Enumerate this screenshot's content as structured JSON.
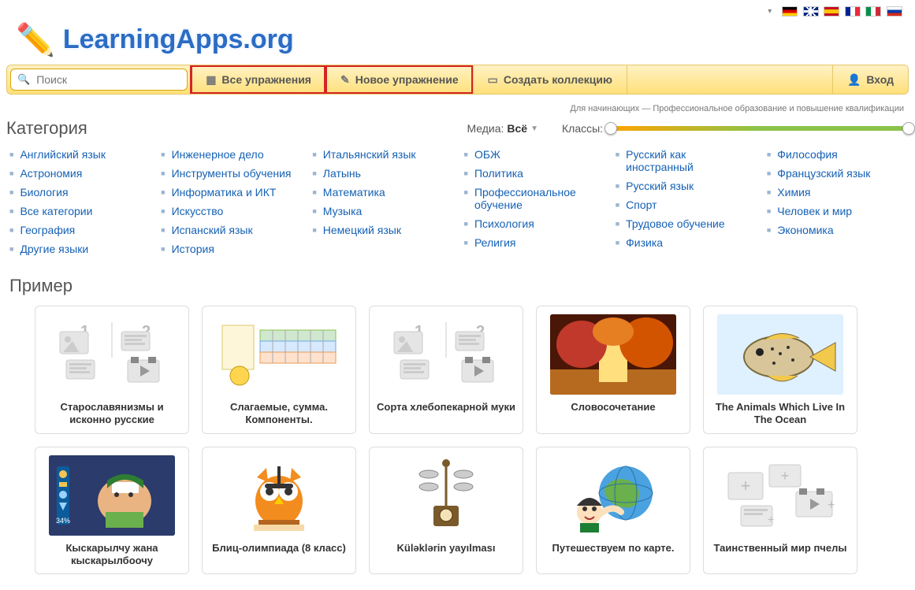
{
  "logo_text": "LearningApps.org",
  "flags": [
    "de",
    "en",
    "es",
    "fr",
    "it",
    "ru"
  ],
  "search": {
    "placeholder": "Поиск"
  },
  "nav": {
    "all": "Все упражнения",
    "new": "Новое упражнение",
    "collection": "Создать коллекцию",
    "login": "Вход"
  },
  "filter": {
    "level_label": "Для начинающих — Профессиональное образование и повышение квалификации",
    "category_heading": "Категория",
    "media_label": "Медиа:",
    "media_value": "Всё",
    "classes_label": "Классы:"
  },
  "categories": [
    [
      "Английский язык",
      "Астрономия",
      "Биология",
      "Все категории",
      "География",
      "Другие языки"
    ],
    [
      "Инженерное дело",
      "Инструменты обучения",
      "Информатика и ИКТ",
      "Искусство",
      "Испанский язык",
      "История"
    ],
    [
      "Итальянский язык",
      "Латынь",
      "Математика",
      "Музыка",
      "Немецкий язык"
    ],
    [
      "ОБЖ",
      "Политика",
      "Профессиональное обучение",
      "Психология",
      "Религия"
    ],
    [
      "Русский как иностранный",
      "Русский язык",
      "Спорт",
      "Трудовое обучение",
      "Физика"
    ],
    [
      "Философия",
      "Французский язык",
      "Химия",
      "Человек и мир",
      "Экономика"
    ]
  ],
  "examples_heading": "Пример",
  "examples": [
    {
      "title": "Старославянизмы и исконно русские",
      "thumb": "pair"
    },
    {
      "title": "Слагаемые, сумма. Компоненты.",
      "thumb": "table"
    },
    {
      "title": "Сорта хлебопекарной муки",
      "thumb": "pair"
    },
    {
      "title": "Словосочетание",
      "thumb": "autumn"
    },
    {
      "title": "The Animals Which Live In The Ocean",
      "thumb": "fish"
    },
    {
      "title": "Кыскарылчу жана кыскарылбоочу",
      "thumb": "lesson"
    },
    {
      "title": "Блиц-олимпиада (8 класс)",
      "thumb": "owl"
    },
    {
      "title": "Küləklərin yayılması",
      "thumb": "device"
    },
    {
      "title": "Путешествуем по карте.",
      "thumb": "globe"
    },
    {
      "title": "Таинственный мир пчелы",
      "thumb": "addplus"
    }
  ]
}
